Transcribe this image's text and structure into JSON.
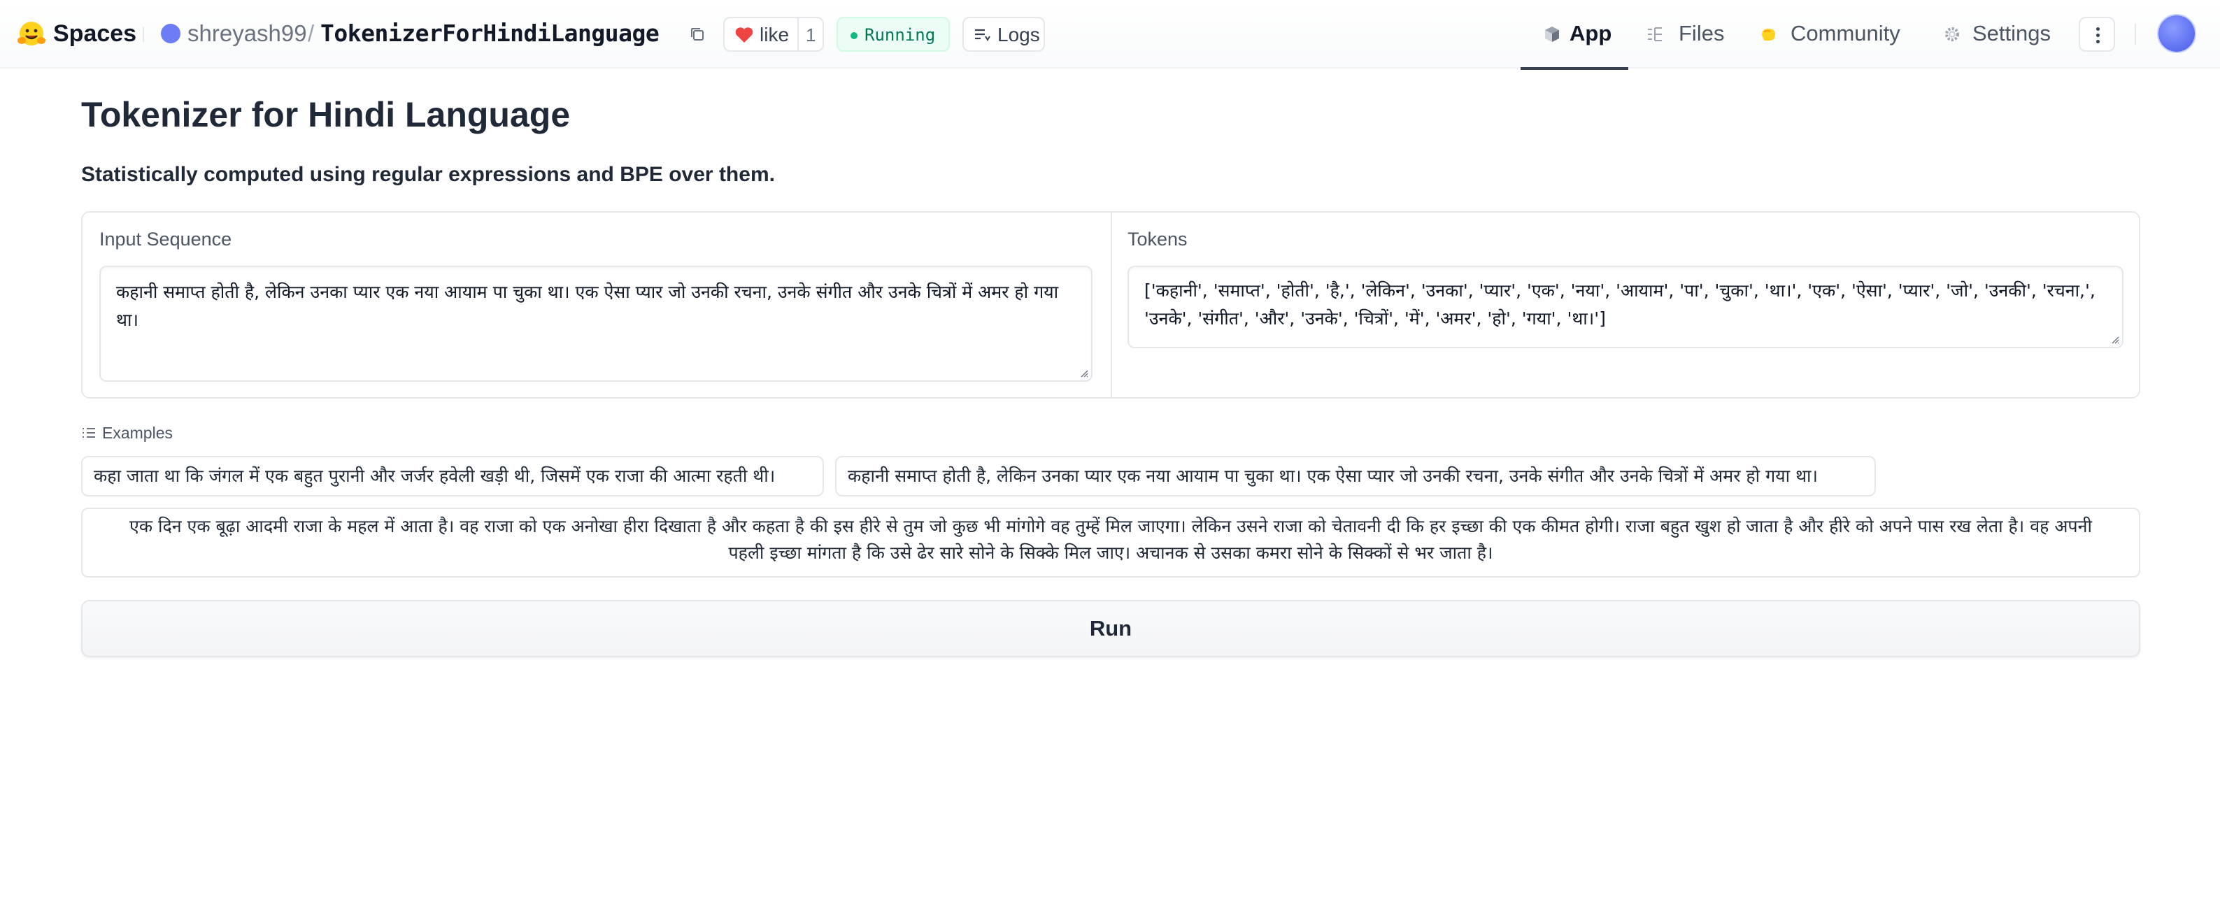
{
  "header": {
    "brand_label": "Spaces",
    "owner": "shreyash99",
    "separator": "/",
    "repo": "TokenizerForHindiLanguage",
    "like_label": "like",
    "like_count": "1",
    "status_label": "Running",
    "logs_label": "Logs",
    "nav": [
      {
        "label": "App",
        "icon": "cube-icon",
        "active": true
      },
      {
        "label": "Files",
        "icon": "files-icon",
        "active": false
      },
      {
        "label": "Community",
        "icon": "community-icon",
        "active": false
      },
      {
        "label": "Settings",
        "icon": "gear-icon",
        "active": false
      }
    ]
  },
  "app": {
    "title": "Tokenizer for Hindi Language",
    "subtitle": "Statistically computed using regular expressions and BPE over them.",
    "input": {
      "label": "Input Sequence",
      "value": "कहानी समाप्त होती है, लेकिन उनका प्यार एक नया आयाम पा चुका था। एक ऐसा प्यार जो उनकी रचना, उनके संगीत और उनके चित्रों में अमर हो गया था।"
    },
    "output": {
      "label": "Tokens",
      "value": "['कहानी', 'समाप्त', 'होती', 'है,', 'लेकिन', 'उनका', 'प्यार', 'एक', 'नया', 'आयाम', 'पा', 'चुका', 'था।', 'एक', 'ऐसा', 'प्यार', 'जो', 'उनकी', 'रचना,', 'उनके', 'संगीत', 'और', 'उनके', 'चित्रों', 'में', 'अमर', 'हो', 'गया', 'था।']"
    },
    "examples_label": "Examples",
    "examples": [
      "कहा जाता था कि जंगल में एक बहुत पुरानी और जर्जर हवेली खड़ी थी, जिसमें एक राजा की आत्मा रहती थी।",
      "कहानी समाप्त होती है, लेकिन उनका प्यार एक नया आयाम पा चुका था। एक ऐसा प्यार जो उनकी रचना, उनके संगीत और उनके चित्रों में अमर हो गया था।",
      "एक दिन एक बूढ़ा आदमी राजा के महल में आता है। वह राजा को एक अनोखा हीरा दिखाता है और कहता है की इस हीरे से तुम जो कुछ भी मांगोगे वह तुम्हें मिल जाएगा। लेकिन उसने राजा को चेतावनी दी कि हर इच्छा की एक कीमत होगी। राजा बहुत खुश हो जाता है और हीरे को अपने पास रख लेता है। वह अपनी पहली इच्छा मांगता है कि उसे ढेर सारे सोने के सिक्के मिल जाए। अचानक से उसका कमरा सोने के सिक्कों से भर जाता है।"
    ],
    "run_label": "Run"
  },
  "colors": {
    "accent_active": "#374151",
    "status_green": "#10b981",
    "heart_red": "#ef4444",
    "avatar_blue": "#5b6ef0"
  }
}
